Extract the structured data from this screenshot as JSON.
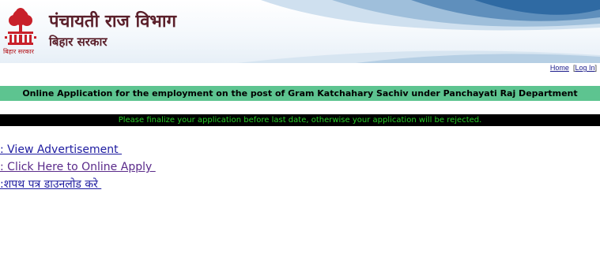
{
  "header": {
    "title": "पंचायती राज विभाग",
    "subtitle": "बिहार सरकार",
    "logo_caption": "बिहार सरकार",
    "logo_icon": "bihar-emblem-icon"
  },
  "topnav": {
    "home": "Home",
    "separator": "|",
    "login": "Log In"
  },
  "page_title": "Online Application for the employment on the post of Gram Katchahary Sachiv under Panchayati Raj Department",
  "notice": "Please finalize your application before last date, otherwise your application will be rejected.",
  "links": [
    {
      "label": ": View Advertisement "
    },
    {
      "label": ": Click Here to Online Apply "
    },
    {
      "label": ":शपथ पत्र डाउनलोड करे "
    }
  ],
  "colors": {
    "title_bar_bg": "#5dc490",
    "notice_bg": "#000000",
    "notice_text": "#27cc27",
    "link": "#1d1ba0",
    "header_text": "#5a1f2a"
  }
}
